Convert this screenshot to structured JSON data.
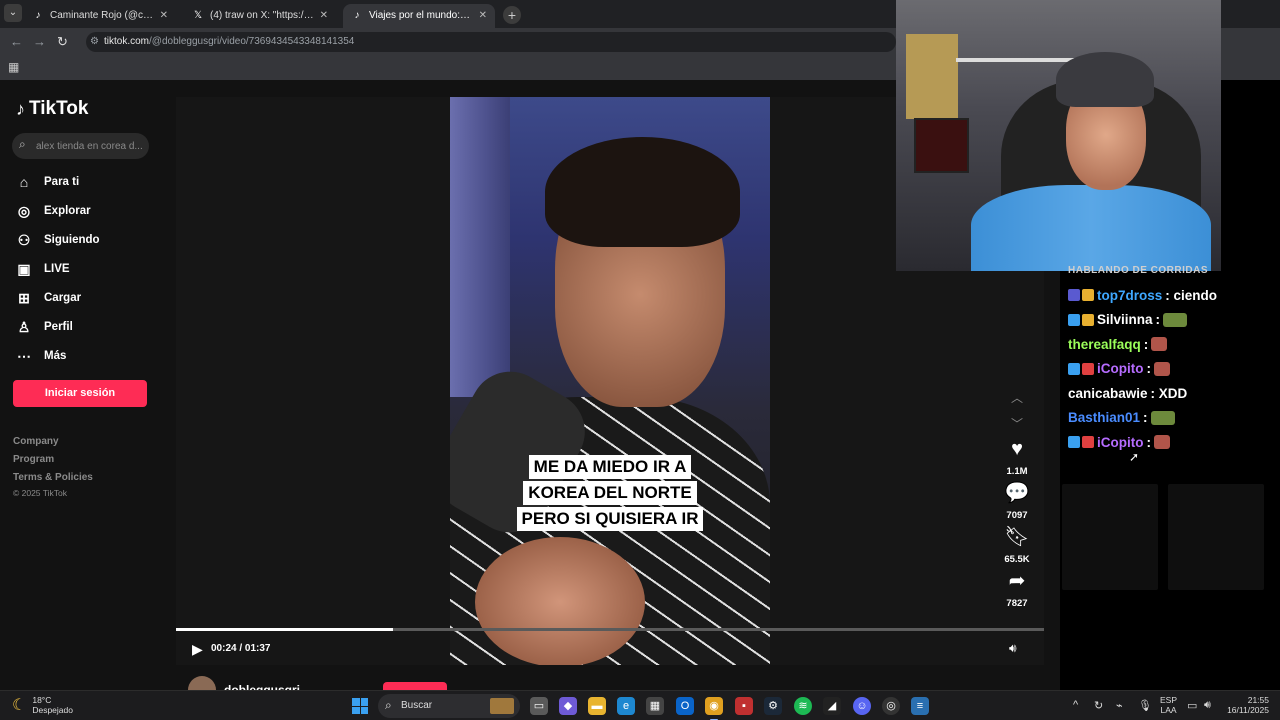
{
  "browser": {
    "tabs": [
      {
        "icon": "tiktok-icon",
        "title": "Caminante Rojo (@caminante.r"
      },
      {
        "icon": "x-icon",
        "title": "(4) traw on X: \"https://t.co/4iFZ"
      },
      {
        "icon": "tiktok-icon",
        "title": "Viajes por el mundo: Miedo de"
      }
    ],
    "url_domain": "tiktok.com",
    "url_path": "/@dobleggusgri/video/7369434543348141354"
  },
  "tiktok": {
    "logo": "TikTok",
    "search_placeholder": "alex tienda en corea d...",
    "nav": [
      {
        "label": "Para ti",
        "icon": "home-icon"
      },
      {
        "label": "Explorar",
        "icon": "compass-icon"
      },
      {
        "label": "Siguiendo",
        "icon": "following-icon"
      },
      {
        "label": "LIVE",
        "icon": "live-icon"
      },
      {
        "label": "Cargar",
        "icon": "upload-icon"
      },
      {
        "label": "Perfil",
        "icon": "profile-icon"
      },
      {
        "label": "Más",
        "icon": "more-icon"
      }
    ],
    "login_label": "Iniciar sesión",
    "footer": [
      "Company",
      "Program",
      "Terms & Policies"
    ],
    "copyright": "© 2025 TikTok",
    "video": {
      "caption_lines": [
        "ME DA MIEDO IR A",
        "KOREA DEL NORTE",
        "PERO SI QUISIERA IR"
      ],
      "time": "00:24 / 01:37",
      "progress": 0.25,
      "author": "dobleggusgri"
    },
    "actions": [
      {
        "icon": "heart-icon",
        "count": "1.1M"
      },
      {
        "icon": "comment-icon",
        "count": "7097"
      },
      {
        "icon": "bookmark-icon",
        "count": "65.5K"
      },
      {
        "icon": "share-icon",
        "count": "7827"
      }
    ]
  },
  "chat": {
    "header": "HABLANDO DE CORRIDAS",
    "messages": [
      {
        "user": "top7dross",
        "color": "#3fa8ff",
        "badges": [
          "#5a5ad0",
          "#e8b030"
        ],
        "message": ": ciendo",
        "emotes": []
      },
      {
        "user": "Silviinna",
        "color": "#ffffff",
        "badges": [
          "#3aa0f0",
          "#e8b030"
        ],
        "message": ":",
        "emotes": [
          "frog"
        ]
      },
      {
        "user": "therealfaqq",
        "color": "#9bff5a",
        "badges": [],
        "message": ":",
        "emotes": [
          "face"
        ]
      },
      {
        "user": "iCopito",
        "color": "#b66cff",
        "badges": [
          "#3aa0f0",
          "#e04040"
        ],
        "message": ":",
        "emotes": [
          "face"
        ]
      },
      {
        "user": "canicabawie",
        "color": "#ffffff",
        "badges": [],
        "message": ": XDD",
        "emotes": []
      },
      {
        "user": "Basthian01",
        "color": "#4a8cff",
        "badges": [],
        "message": ":",
        "emotes": [
          "frog"
        ]
      },
      {
        "user": "iCopito",
        "color": "#b66cff",
        "badges": [
          "#3aa0f0",
          "#e04040"
        ],
        "message": ":",
        "emotes": [
          "face"
        ]
      }
    ]
  },
  "taskbar": {
    "weather_temp": "18°C",
    "weather_desc": "Despejado",
    "search_label": "Buscar",
    "lang_1": "ESP",
    "lang_2": "LAA",
    "time": "21:55",
    "date": "16/11/2025"
  },
  "colors": {
    "accent": "#fe2c55",
    "page_bg": "#121212",
    "chrome_bg": "#35363a"
  }
}
